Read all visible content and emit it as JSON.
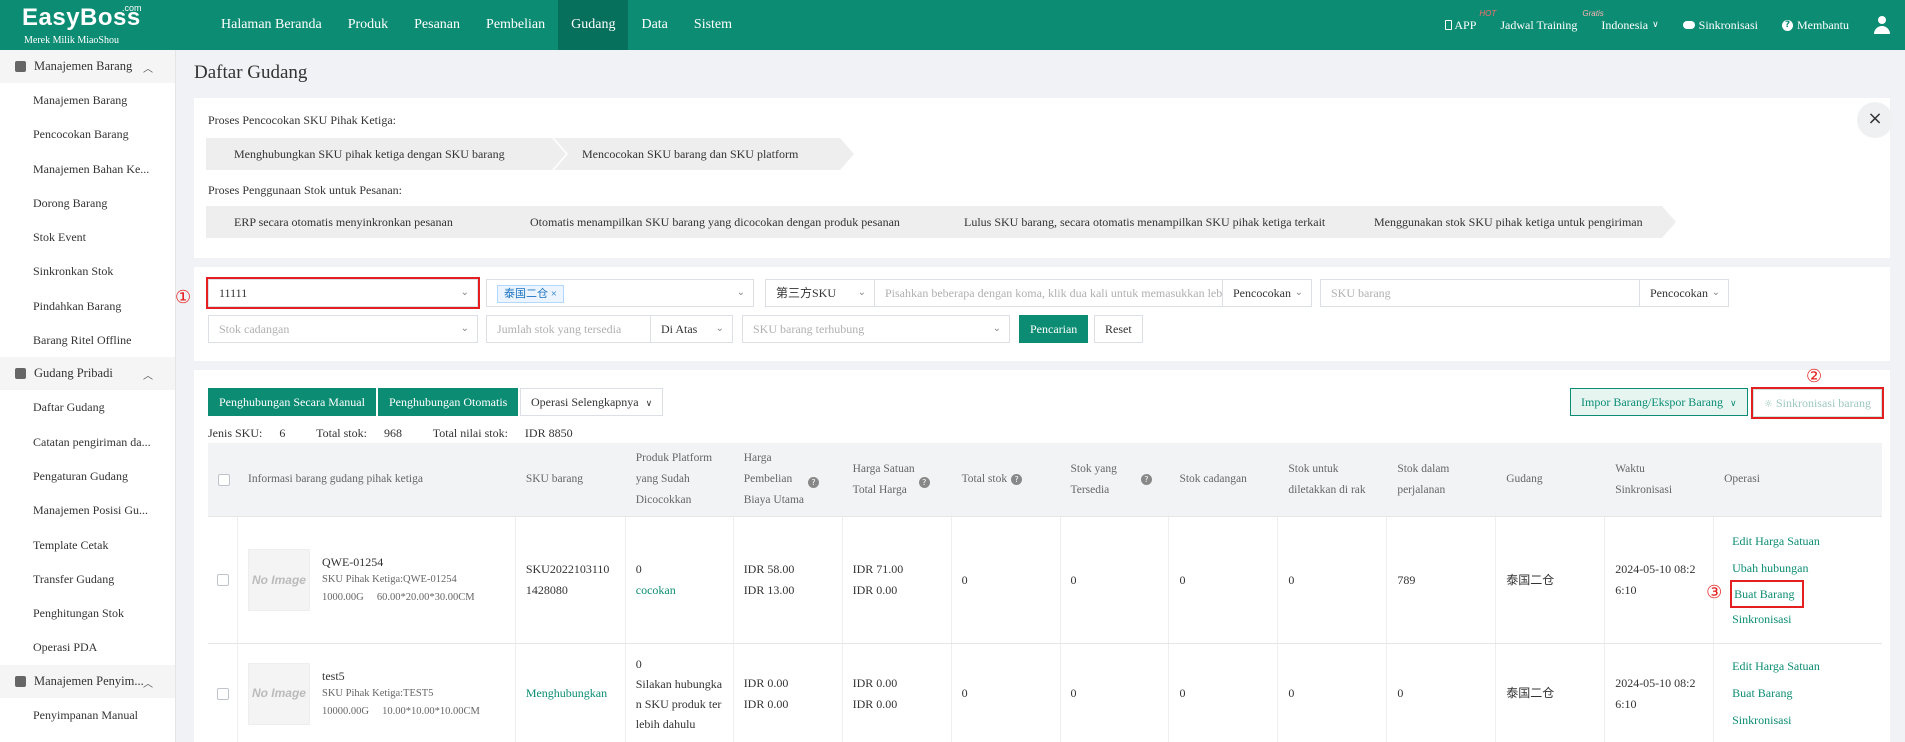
{
  "header": {
    "brand": "EasyBoss",
    "brand_com": ".com",
    "brand_sub": "Merek Milik MiaoShou",
    "nav": [
      "Halaman Beranda",
      "Produk",
      "Pesanan",
      "Pembelian",
      "Gudang",
      "Data",
      "Sistem"
    ],
    "active_nav": "Gudang",
    "app": "APP",
    "app_badge": "HOT",
    "training": "Jadwal Training",
    "training_badge": "Gratis",
    "language": "Indonesia",
    "sync": "Sinkronisasi",
    "help": "Membantu"
  },
  "sidebar": {
    "group1": "Manajemen Barang",
    "group1_items": [
      "Manajemen Barang",
      "Pencocokan Barang",
      "Manajemen Bahan Ke...",
      "Dorong Barang",
      "Stok Event",
      "Sinkronkan Stok",
      "Pindahkan Barang",
      "Barang Ritel Offline"
    ],
    "group2": "Gudang Pribadi",
    "group2_items": [
      "Daftar Gudang",
      "Catatan pengiriman da...",
      "Pengaturan Gudang",
      "Manajemen Posisi Gu...",
      "Template Cetak",
      "Transfer Gudang",
      "Penghitungan Stok",
      "Operasi PDA"
    ],
    "group3": "Manajemen Penyim...",
    "group3_items": [
      "Penyimpanan Manual"
    ]
  },
  "page_title": "Daftar Gudang",
  "process": {
    "label1": "Proses Pencocokan SKU Pihak Ketiga:",
    "steps1": [
      "Menghubungkan SKU pihak ketiga dengan SKU barang",
      "Mencocokan SKU barang dan SKU platform"
    ],
    "label2": "Proses Penggunaan Stok untuk Pesanan:",
    "steps2": [
      "ERP secara otomatis menyinkronkan pesanan",
      "Otomatis menampilkan SKU barang yang dicocokan dengan produk pesanan",
      "Lulus SKU barang, secara otomatis menampilkan SKU pihak ketiga terkait",
      "Menggunakan stok SKU pihak ketiga untuk pengiriman"
    ],
    "close": "×"
  },
  "filters": {
    "warehouse_value": "11111",
    "warehouse_tag": "泰国二仓",
    "sku_type": "第三方SKU",
    "sku_input_placeholder": "Pisahkan beberapa dengan koma, klik dua kali untuk memasukkan lebih banyak",
    "match_mode1": "Pencocokan",
    "sku_barang_placeholder": "SKU barang",
    "match_mode2": "Pencocokan",
    "stok_cadangan_placeholder": "Stok cadangan",
    "jumlah_stok_placeholder": "Jumlah stok yang tersedia",
    "di_atas": "Di Atas",
    "sku_terhubung_placeholder": "SKU barang terhubung",
    "search": "Pencarian",
    "reset": "Reset"
  },
  "annotations": [
    "①",
    "②",
    "③"
  ],
  "toolbar": {
    "manual": "Penghubungan Secara Manual",
    "auto": "Penghubungan Otomatis",
    "more": "Operasi Selengkapnya",
    "import_export": "Impor Barang/Ekspor Barang",
    "sync_goods": "Sinkronisasi barang"
  },
  "stats": {
    "jenis_label": "Jenis SKU:",
    "jenis_value": "6",
    "total_label": "Total stok:",
    "total_value": "968",
    "nilai_label": "Total nilai stok:",
    "nilai_value": "IDR 8850"
  },
  "table": {
    "headers": {
      "info": "Informasi barang gudang pihak ketiga",
      "sku": "SKU barang",
      "platform": [
        "Produk Platform",
        "yang Sudah",
        "Dicocokkan"
      ],
      "harga_beli": [
        "Harga",
        "Pembelian",
        "Biaya Utama"
      ],
      "harga_satuan": [
        "Harga Satuan",
        "Total Harga"
      ],
      "total_stok": "Total stok",
      "tersedia": [
        "Stok yang",
        "Tersedia"
      ],
      "cadangan": "Stok cadangan",
      "rak": [
        "Stok untuk",
        "diletakkan di rak"
      ],
      "perjalanan": [
        "Stok dalam",
        "perjalanan"
      ],
      "gudang": "Gudang",
      "waktu": [
        "Waktu",
        "Sinkronisasi"
      ],
      "operasi": "Operasi"
    },
    "rows": [
      {
        "img": "No Image",
        "name": "QWE-01254",
        "sku3": "SKU Pihak Ketiga:QWE-01254",
        "weight": "1000.00G",
        "dims": "60.00*20.00*30.00CM",
        "sku_barang": [
          "SKU2022103110",
          "1428080"
        ],
        "platform_count": "0",
        "platform_link": "cocokan",
        "harga_beli": [
          "IDR 58.00",
          "IDR 13.00"
        ],
        "harga_satuan": [
          "IDR 71.00",
          "IDR 0.00"
        ],
        "total_stok": "0",
        "tersedia": "0",
        "cadangan": "0",
        "rak": "0",
        "perjalanan": "789",
        "gudang": "泰国二仓",
        "waktu": [
          "2024-05-10 08:2",
          "6:10"
        ],
        "ops": [
          "Edit Harga Satuan",
          "Ubah hubungan",
          "Buat Barang",
          "Sinkronisasi"
        ]
      },
      {
        "img": "No Image",
        "name": "test5",
        "sku3": "SKU Pihak Ketiga:TEST5",
        "weight": "10000.00G",
        "dims": "10.00*10.00*10.00CM",
        "sku_link": "Menghubungkan",
        "platform_count": "0",
        "platform_text": [
          "Silakan hubungka",
          "n SKU produk ter",
          "lebih dahulu"
        ],
        "harga_beli": [
          "IDR 0.00",
          "IDR 0.00"
        ],
        "harga_satuan": [
          "IDR 0.00",
          "IDR 0.00"
        ],
        "total_stok": "0",
        "tersedia": "0",
        "cadangan": "0",
        "rak": "0",
        "perjalanan": "0",
        "gudang": "泰国二仓",
        "waktu": [
          "2024-05-10 08:2",
          "6:10"
        ],
        "ops": [
          "Edit Harga Satuan",
          "Buat Barang",
          "Sinkronisasi"
        ]
      }
    ]
  }
}
